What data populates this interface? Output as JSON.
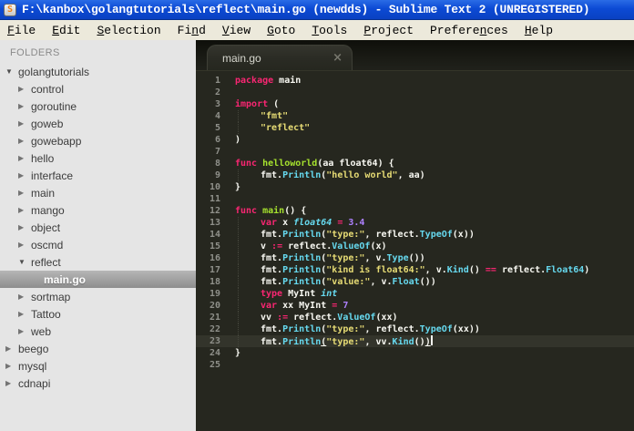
{
  "window": {
    "title": "F:\\kanbox\\golangtutorials\\reflect\\main.go (newdds) - Sublime Text 2 (UNREGISTERED)",
    "icon_letter": "S"
  },
  "menu": {
    "items": [
      {
        "label": "File",
        "u": 0
      },
      {
        "label": "Edit",
        "u": 0
      },
      {
        "label": "Selection",
        "u": 0
      },
      {
        "label": "Find",
        "u": 2
      },
      {
        "label": "View",
        "u": 0
      },
      {
        "label": "Goto",
        "u": 0
      },
      {
        "label": "Tools",
        "u": 0
      },
      {
        "label": "Project",
        "u": 0
      },
      {
        "label": "Preferences",
        "u": 7
      },
      {
        "label": "Help",
        "u": 0
      }
    ]
  },
  "sidebar": {
    "header": "FOLDERS",
    "tree": [
      {
        "label": "golangtutorials",
        "depth": 0,
        "state": "expanded"
      },
      {
        "label": "control",
        "depth": 1,
        "state": "collapsed"
      },
      {
        "label": "goroutine",
        "depth": 1,
        "state": "collapsed"
      },
      {
        "label": "goweb",
        "depth": 1,
        "state": "collapsed"
      },
      {
        "label": "gowebapp",
        "depth": 1,
        "state": "collapsed"
      },
      {
        "label": "hello",
        "depth": 1,
        "state": "collapsed"
      },
      {
        "label": "interface",
        "depth": 1,
        "state": "collapsed"
      },
      {
        "label": "main",
        "depth": 1,
        "state": "collapsed"
      },
      {
        "label": "mango",
        "depth": 1,
        "state": "collapsed"
      },
      {
        "label": "object",
        "depth": 1,
        "state": "collapsed"
      },
      {
        "label": "oscmd",
        "depth": 1,
        "state": "collapsed"
      },
      {
        "label": "reflect",
        "depth": 1,
        "state": "expanded"
      },
      {
        "label": "main.go",
        "depth": 2,
        "state": "file",
        "selected": true
      },
      {
        "label": "sortmap",
        "depth": 1,
        "state": "collapsed"
      },
      {
        "label": "Tattoo",
        "depth": 1,
        "state": "collapsed"
      },
      {
        "label": "web",
        "depth": 1,
        "state": "collapsed"
      },
      {
        "label": "beego",
        "depth": 0,
        "state": "collapsed"
      },
      {
        "label": "mysql",
        "depth": 0,
        "state": "collapsed"
      },
      {
        "label": "cdnapi",
        "depth": 0,
        "state": "collapsed"
      }
    ]
  },
  "editor": {
    "tab": {
      "label": "main.go",
      "close_icon": "×"
    },
    "colors": {
      "background": "#26271f",
      "keyword": "#f92672",
      "function": "#a6e22e",
      "string": "#e6db74",
      "call": "#66d9ef",
      "number": "#ae81ff",
      "foreground": "#f8f8f2",
      "gutter": "#8f908a",
      "titlebar_blue": "#0c4ad4",
      "sidebar_bg": "#e5e5e5"
    },
    "lines": [
      {
        "n": 1,
        "ind": 0,
        "t": [
          [
            "k",
            "package"
          ],
          [
            "w",
            " main"
          ]
        ]
      },
      {
        "n": 2,
        "ind": 0,
        "t": []
      },
      {
        "n": 3,
        "ind": 0,
        "t": [
          [
            "k",
            "import"
          ],
          [
            "w",
            " ("
          ]
        ]
      },
      {
        "n": 4,
        "ind": 1,
        "t": [
          [
            "s",
            "\"fmt\""
          ]
        ]
      },
      {
        "n": 5,
        "ind": 1,
        "t": [
          [
            "s",
            "\"reflect\""
          ]
        ]
      },
      {
        "n": 6,
        "ind": 0,
        "t": [
          [
            "w",
            ")"
          ]
        ]
      },
      {
        "n": 7,
        "ind": 0,
        "t": []
      },
      {
        "n": 8,
        "ind": 0,
        "t": [
          [
            "k",
            "func"
          ],
          [
            "w",
            " "
          ],
          [
            "f",
            "helloworld"
          ],
          [
            "w",
            "(aa float64) {"
          ]
        ]
      },
      {
        "n": 9,
        "ind": 1,
        "t": [
          [
            "w",
            "fmt."
          ],
          [
            "c",
            "Println"
          ],
          [
            "w",
            "("
          ],
          [
            "s",
            "\"hello world\""
          ],
          [
            "w",
            ", aa)"
          ]
        ]
      },
      {
        "n": 10,
        "ind": 0,
        "t": [
          [
            "w",
            "}"
          ]
        ]
      },
      {
        "n": 11,
        "ind": 0,
        "t": []
      },
      {
        "n": 12,
        "ind": 0,
        "t": [
          [
            "k",
            "func"
          ],
          [
            "w",
            " "
          ],
          [
            "f",
            "main"
          ],
          [
            "w",
            "() {"
          ]
        ]
      },
      {
        "n": 13,
        "ind": 1,
        "t": [
          [
            "k",
            "var"
          ],
          [
            "w",
            " x "
          ],
          [
            "ci",
            "float64"
          ],
          [
            "w",
            " "
          ],
          [
            "k",
            "="
          ],
          [
            "w",
            " "
          ],
          [
            "n2",
            "3.4"
          ]
        ]
      },
      {
        "n": 14,
        "ind": 1,
        "t": [
          [
            "w",
            "fmt."
          ],
          [
            "c",
            "Println"
          ],
          [
            "w",
            "("
          ],
          [
            "s",
            "\"type:\""
          ],
          [
            "w",
            ", reflect."
          ],
          [
            "c",
            "TypeOf"
          ],
          [
            "w",
            "(x))"
          ]
        ]
      },
      {
        "n": 15,
        "ind": 1,
        "t": [
          [
            "w",
            "v "
          ],
          [
            "k",
            ":="
          ],
          [
            "w",
            " reflect."
          ],
          [
            "c",
            "ValueOf"
          ],
          [
            "w",
            "(x)"
          ]
        ]
      },
      {
        "n": 16,
        "ind": 1,
        "t": [
          [
            "w",
            "fmt."
          ],
          [
            "c",
            "Println"
          ],
          [
            "w",
            "("
          ],
          [
            "s",
            "\"type:\""
          ],
          [
            "w",
            ", v."
          ],
          [
            "c",
            "Type"
          ],
          [
            "w",
            "())"
          ]
        ]
      },
      {
        "n": 17,
        "ind": 1,
        "t": [
          [
            "w",
            "fmt."
          ],
          [
            "c",
            "Println"
          ],
          [
            "w",
            "("
          ],
          [
            "s",
            "\"kind is float64:\""
          ],
          [
            "w",
            ", v."
          ],
          [
            "c",
            "Kind"
          ],
          [
            "w",
            "() "
          ],
          [
            "k",
            "=="
          ],
          [
            "w",
            " reflect."
          ],
          [
            "c",
            "Float64"
          ],
          [
            "w",
            ")"
          ]
        ]
      },
      {
        "n": 18,
        "ind": 1,
        "t": [
          [
            "w",
            "fmt."
          ],
          [
            "c",
            "Println"
          ],
          [
            "w",
            "("
          ],
          [
            "s",
            "\"value:\""
          ],
          [
            "w",
            ", v."
          ],
          [
            "c",
            "Float"
          ],
          [
            "w",
            "())"
          ]
        ]
      },
      {
        "n": 19,
        "ind": 1,
        "t": [
          [
            "k",
            "type"
          ],
          [
            "w",
            " MyInt "
          ],
          [
            "ci",
            "int"
          ]
        ]
      },
      {
        "n": 20,
        "ind": 1,
        "t": [
          [
            "k",
            "var"
          ],
          [
            "w",
            " xx MyInt "
          ],
          [
            "k",
            "="
          ],
          [
            "w",
            " "
          ],
          [
            "n2",
            "7"
          ]
        ]
      },
      {
        "n": 21,
        "ind": 1,
        "t": [
          [
            "w",
            "vv "
          ],
          [
            "k",
            ":="
          ],
          [
            "w",
            " reflect."
          ],
          [
            "c",
            "ValueOf"
          ],
          [
            "w",
            "(xx)"
          ]
        ]
      },
      {
        "n": 22,
        "ind": 1,
        "t": [
          [
            "w",
            "fmt."
          ],
          [
            "c",
            "Println"
          ],
          [
            "w",
            "("
          ],
          [
            "s",
            "\"type:\""
          ],
          [
            "w",
            ", reflect."
          ],
          [
            "c",
            "TypeOf"
          ],
          [
            "w",
            "(xx))"
          ]
        ]
      },
      {
        "n": 23,
        "ind": 1,
        "active": true,
        "t": [
          [
            "w",
            "fmt."
          ],
          [
            "c",
            "Println"
          ],
          [
            "wu",
            "("
          ],
          [
            "s",
            "\"type:\""
          ],
          [
            "w",
            ", vv."
          ],
          [
            "c",
            "Kind"
          ],
          [
            "w",
            "()"
          ],
          [
            "wu",
            ")"
          ],
          [
            "caret",
            ""
          ]
        ]
      },
      {
        "n": 24,
        "ind": 0,
        "t": [
          [
            "w",
            "}"
          ]
        ]
      },
      {
        "n": 25,
        "ind": 0,
        "t": []
      }
    ]
  }
}
